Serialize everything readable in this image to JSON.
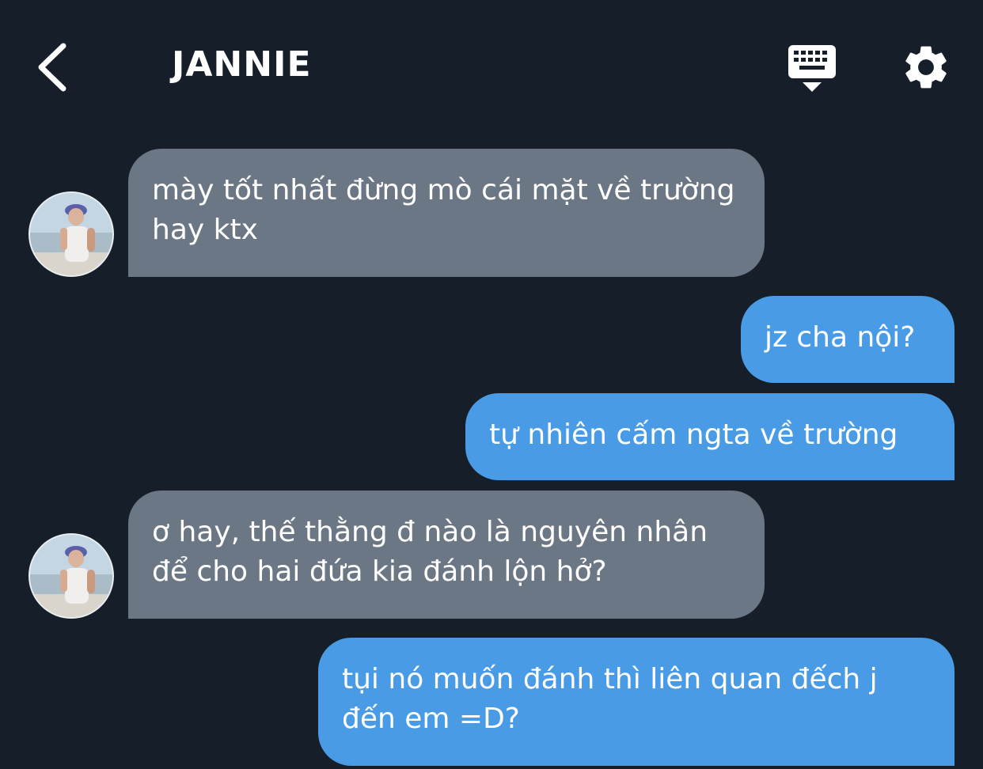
{
  "header": {
    "contact_name": "JANNIE",
    "back_icon": "chevron-left-icon",
    "keyboard_icon": "keyboard-hide-icon",
    "settings_icon": "gear-icon"
  },
  "messages": [
    {
      "direction": "incoming",
      "text": "mày tốt nhất đừng mò cái mặt về trường hay ktx"
    },
    {
      "direction": "outgoing",
      "text": "jz cha nội?"
    },
    {
      "direction": "outgoing",
      "text": "tự nhiên cấm ngta về trường"
    },
    {
      "direction": "incoming",
      "text": "ơ hay, thế thằng đ nào là nguyên nhân để cho hai đứa kia đánh lộn hở?"
    },
    {
      "direction": "outgoing",
      "text": "tụi nó muốn đánh thì liên quan đếch j đến em =D?"
    }
  ],
  "colors": {
    "background": "#161e29",
    "incoming_bubble": "#6b7785",
    "outgoing_bubble": "#4a9be6",
    "text": "#ffffff"
  }
}
